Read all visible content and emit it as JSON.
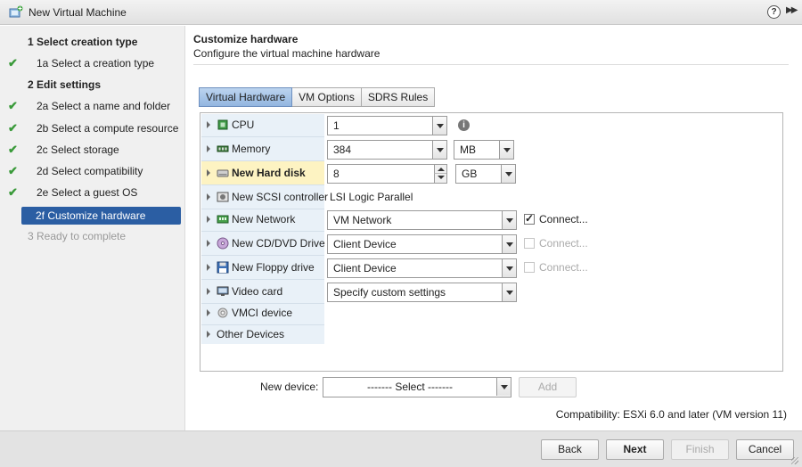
{
  "window": {
    "title": "New Virtual Machine",
    "help_label": "?"
  },
  "steps": [
    {
      "label": "1  Select creation type",
      "state": "group"
    },
    {
      "label": "1a  Select a creation type",
      "state": "done"
    },
    {
      "label": "2  Edit settings",
      "state": "group"
    },
    {
      "label": "2a  Select a name and folder",
      "state": "done"
    },
    {
      "label": "2b  Select a compute resource",
      "state": "done"
    },
    {
      "label": "2c  Select storage",
      "state": "done"
    },
    {
      "label": "2d  Select compatibility",
      "state": "done"
    },
    {
      "label": "2e  Select a guest OS",
      "state": "done"
    },
    {
      "label": "2f  Customize hardware",
      "state": "active"
    },
    {
      "label": "3  Ready to complete",
      "state": "disabled"
    }
  ],
  "header": {
    "title": "Customize hardware",
    "subtitle": "Configure the virtual machine hardware"
  },
  "tabs": [
    "Virtual Hardware",
    "VM Options",
    "SDRS Rules"
  ],
  "devices": {
    "cpu": {
      "label": "CPU",
      "value": "1"
    },
    "memory": {
      "label": "Memory",
      "value": "384",
      "unit": "MB"
    },
    "hard_disk": {
      "label": "New Hard disk",
      "value": "8",
      "unit": "GB"
    },
    "scsi": {
      "label": "New SCSI controller",
      "value": "LSI Logic Parallel"
    },
    "network": {
      "label": "New Network",
      "value": "VM Network",
      "connect": "Connect...",
      "connected": true
    },
    "cdrom": {
      "label": "New CD/DVD Drive",
      "value": "Client Device",
      "connect": "Connect...",
      "connected": false
    },
    "floppy": {
      "label": "New Floppy drive",
      "value": "Client Device",
      "connect": "Connect...",
      "connected": false
    },
    "video": {
      "label": "Video card",
      "value": "Specify custom settings"
    },
    "vmci": {
      "label": "VMCI device"
    },
    "other": {
      "label": "Other Devices"
    }
  },
  "new_device": {
    "label": "New device:",
    "value": "------- Select -------",
    "add_label": "Add"
  },
  "compatibility": "Compatibility: ESXi 6.0 and later (VM version 11)",
  "footer": {
    "back": "Back",
    "next": "Next",
    "finish": "Finish",
    "cancel": "Cancel"
  },
  "colors": {
    "accent": "#2b5ea3",
    "check": "#3a9a3a",
    "highlight": "#fdf3c2",
    "label_column": "#e9f1f8"
  }
}
